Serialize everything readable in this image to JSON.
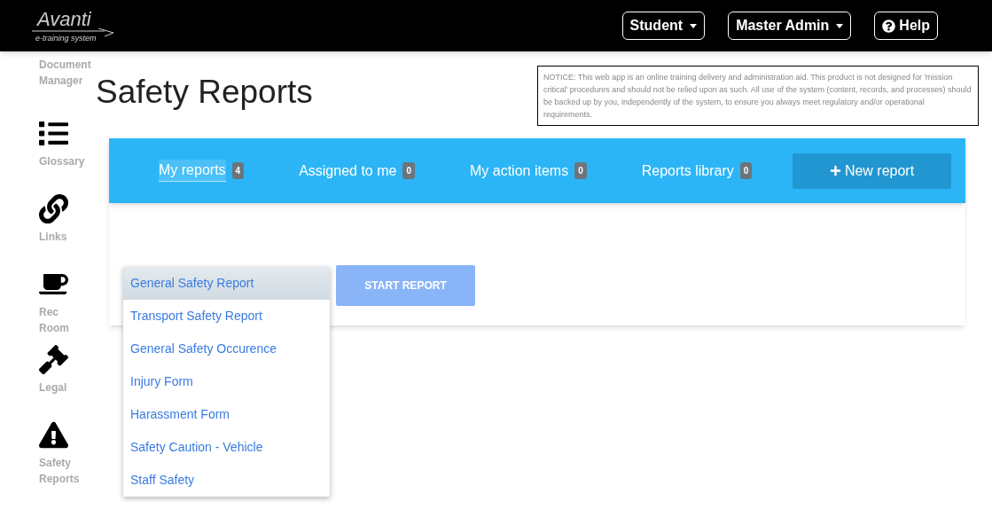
{
  "logo": {
    "name": "Avanti",
    "tagline": "e-training system"
  },
  "header_buttons": [
    {
      "label": "Student",
      "kind": "dropdown"
    },
    {
      "label": "Master Admin",
      "kind": "dropdown"
    },
    {
      "label": "Help",
      "kind": "help"
    }
  ],
  "sidebar": {
    "items": [
      {
        "label": "Document Manager",
        "kind": "document"
      },
      {
        "label": "Glossary",
        "kind": "list"
      },
      {
        "label": "Links",
        "kind": "link"
      },
      {
        "label": "Rec Room",
        "kind": "cup"
      },
      {
        "label": "Legal",
        "kind": "gavel"
      },
      {
        "label": "Safety Reports",
        "kind": "warning"
      }
    ]
  },
  "page_title": "Safety Reports",
  "notice": "NOTICE: This web app is an online training delivery and administration aid. This product is not designed for 'mission critical' procedures and should not be relied upon as such. All use of the system (content, records, and processes) should be backed up by you, independently of the system, to ensure you always meet regulatory and/or operational requirements.",
  "tabs": [
    {
      "label": "My reports",
      "count": "4",
      "selected": true
    },
    {
      "label": "Assigned to me",
      "count": "0",
      "selected": false
    },
    {
      "label": "My action items",
      "count": "0",
      "selected": false
    },
    {
      "label": "Reports library",
      "count": "0",
      "selected": false
    }
  ],
  "new_report_button": "New report",
  "report_type_dropdown": {
    "expanded": true,
    "options": [
      {
        "label": "General Safety Report",
        "selected": true
      },
      {
        "label": "Transport Safety Report",
        "selected": false
      },
      {
        "label": "General Safety Occurence",
        "selected": false
      },
      {
        "label": "Injury Form",
        "selected": false
      },
      {
        "label": "Harassment Form",
        "selected": false
      },
      {
        "label": "Safety Caution - Vehicle",
        "selected": false
      },
      {
        "label": "Staff Safety",
        "selected": false
      }
    ]
  },
  "start_report_button": {
    "label": "START REPORT",
    "disabled": true
  }
}
